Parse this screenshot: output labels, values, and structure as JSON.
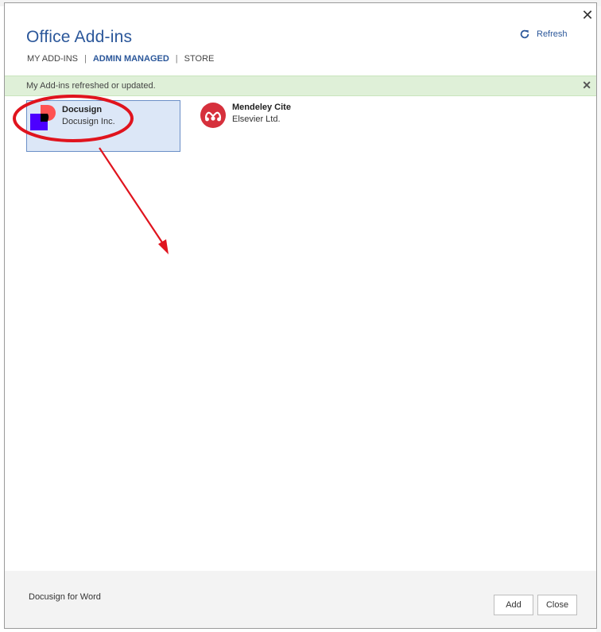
{
  "dialog": {
    "title": "Office Add-ins",
    "refresh_label": "Refresh",
    "close_glyph": "✕"
  },
  "tabs": [
    {
      "label": "MY ADD-INS",
      "active": false
    },
    {
      "label": "ADMIN MANAGED",
      "active": true
    },
    {
      "label": "STORE",
      "active": false
    }
  ],
  "tab_separator": "|",
  "notice": {
    "message": "My Add-ins refreshed or updated.",
    "dismiss_glyph": "✕"
  },
  "addins": [
    {
      "name": "Docusign",
      "publisher": "Docusign Inc.",
      "icon": "docusign-logo-icon",
      "selected": true
    },
    {
      "name": "Mendeley Cite",
      "publisher": "Elsevier Ltd.",
      "icon": "mendeley-logo-icon",
      "selected": false
    }
  ],
  "footer": {
    "description": "Docusign for Word",
    "add_label": "Add",
    "close_label": "Close"
  },
  "colors": {
    "accent": "#2b579a",
    "notice_bg": "#dff0d8",
    "selected_bg": "#dce7f7",
    "annotation_red": "#e0141e",
    "docusign_purple": "#4c00ff",
    "docusign_coral": "#ff5252",
    "mendeley_red": "#d6303c"
  }
}
